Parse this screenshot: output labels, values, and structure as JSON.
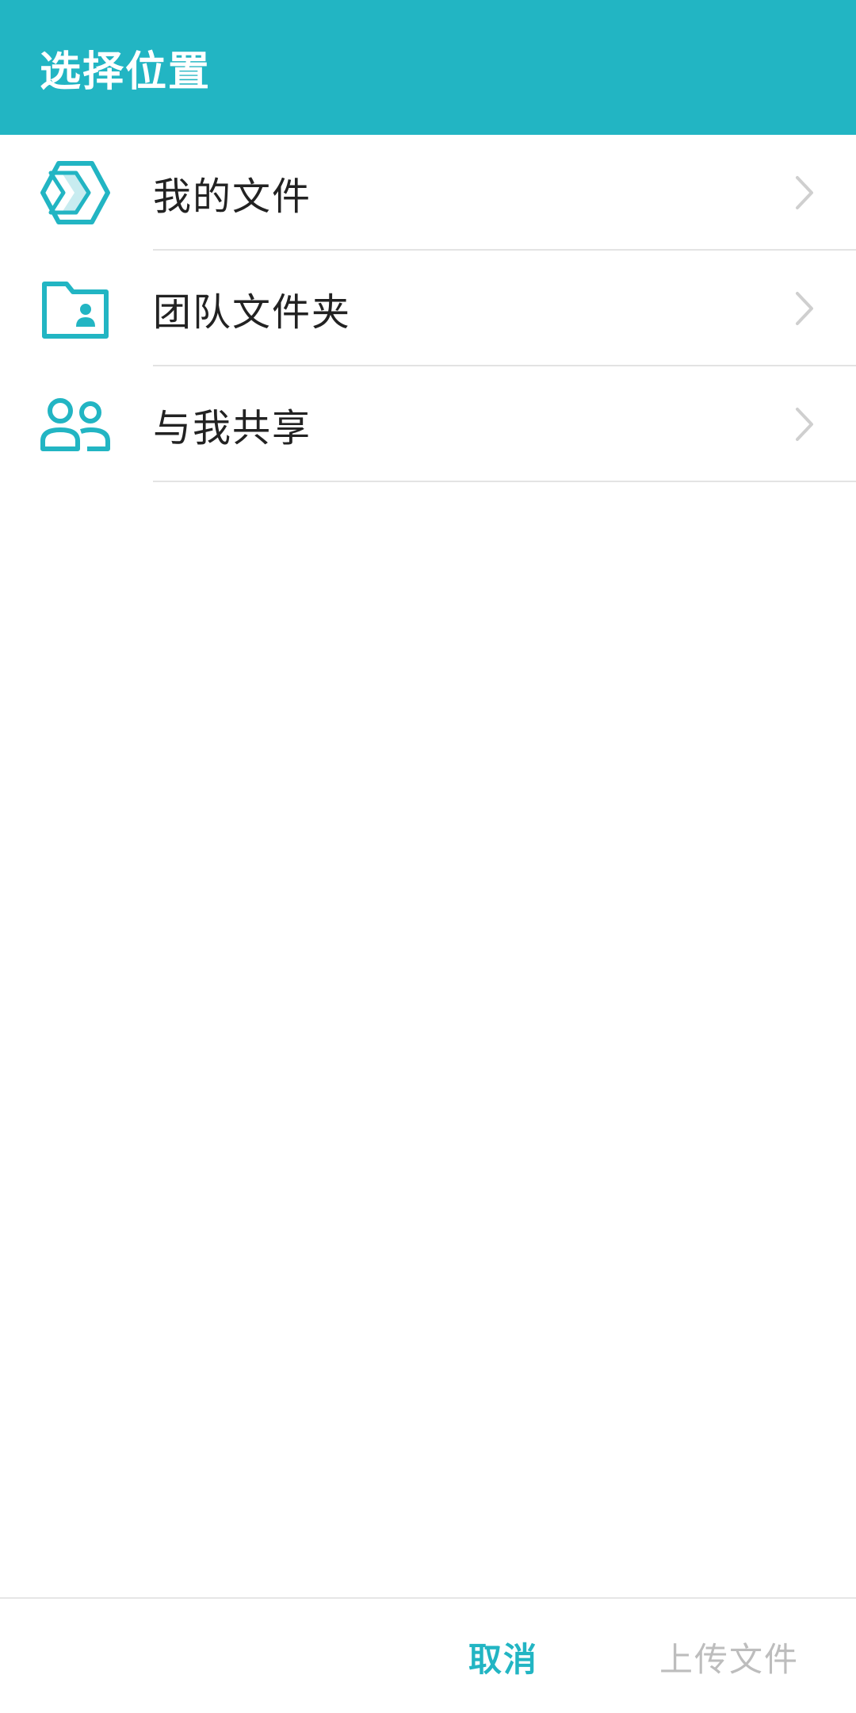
{
  "header": {
    "title": "选择位置"
  },
  "colors": {
    "accent": "#22b5c3",
    "disabled": "#bdbdbd",
    "divider": "#e3e3e3"
  },
  "locations": [
    {
      "label": "我的文件",
      "icon": "my-files-icon"
    },
    {
      "label": "团队文件夹",
      "icon": "team-folder-icon"
    },
    {
      "label": "与我共享",
      "icon": "shared-with-me-icon"
    }
  ],
  "footer": {
    "cancel_label": "取消",
    "upload_label": "上传文件"
  }
}
